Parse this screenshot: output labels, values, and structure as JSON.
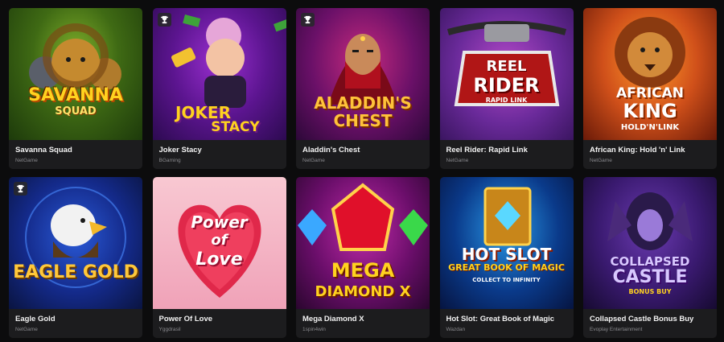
{
  "games": [
    {
      "title": "Savanna Squad",
      "provider": "NetGame",
      "trophy": false,
      "logo": [
        "SAVANNA",
        "SQUAD"
      ]
    },
    {
      "title": "Joker Stacy",
      "provider": "BGaming",
      "trophy": true,
      "logo": [
        "JOKER",
        "STACY"
      ]
    },
    {
      "title": "Aladdin's Chest",
      "provider": "NetGame",
      "trophy": true,
      "logo": [
        "ALADDIN'S",
        "CHEST"
      ]
    },
    {
      "title": "Reel Rider: Rapid Link",
      "provider": "NetGame",
      "trophy": false,
      "logo": [
        "REEL",
        "RIDER",
        "RAPID LINK"
      ]
    },
    {
      "title": "African King: Hold 'n' Link",
      "provider": "NetGame",
      "trophy": false,
      "logo": [
        "AFRICAN",
        "KING",
        "HOLD'N'LINK"
      ]
    },
    {
      "title": "Eagle Gold",
      "provider": "NetGame",
      "trophy": true,
      "logo": [
        "EAGLE GOLD"
      ]
    },
    {
      "title": "Power Of Love",
      "provider": "Yggdrasil",
      "trophy": false,
      "logo": [
        "Power",
        "of",
        "Love"
      ]
    },
    {
      "title": "Mega Diamond X",
      "provider": "1spin4win",
      "trophy": false,
      "logo": [
        "MEGA",
        "DIAMOND X"
      ]
    },
    {
      "title": "Hot Slot: Great Book of Magic",
      "provider": "Wazdan",
      "trophy": false,
      "logo": [
        "HOT SLOT",
        "GREAT BOOK OF MAGIC",
        "COLLECT TO INFINITY"
      ]
    },
    {
      "title": "Collapsed Castle Bonus Buy",
      "provider": "Evoplay Entertainment",
      "trophy": false,
      "logo": [
        "COLLAPSED",
        "CASTLE",
        "BONUS BUY"
      ]
    }
  ],
  "colors": {
    "background": "#0c0c0d",
    "card": "#1c1c1e",
    "title": "#f2f2f2",
    "provider": "#8a8a8e"
  }
}
